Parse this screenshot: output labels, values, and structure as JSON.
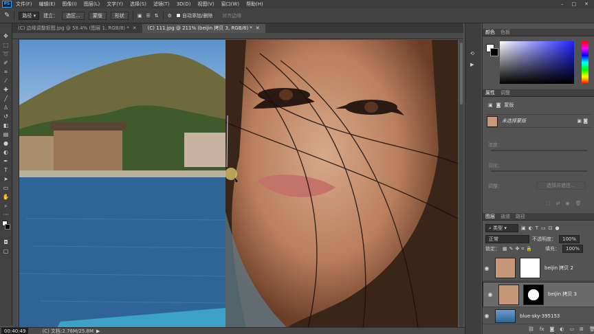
{
  "app": {
    "logo": "PS"
  },
  "menubar": {
    "items": [
      "文件(F)",
      "编辑(E)",
      "图像(I)",
      "图层(L)",
      "文字(Y)",
      "选择(S)",
      "滤镜(T)",
      "3D(D)",
      "视图(V)",
      "窗口(W)",
      "帮助(H)"
    ],
    "window_controls": [
      "–",
      "□",
      "✕"
    ]
  },
  "options_bar": {
    "tool_icon": "pen-icon",
    "mode_value": "路径",
    "make_label": "建立：",
    "selection_button": "选区...",
    "mask_button": "蒙版",
    "shape_button": "形状",
    "auto_add_delete": "自动添加/删除",
    "align_edges": "对齐边缘"
  },
  "tabs": [
    {
      "label": "(C) 边缘调整抠图.jpg @ 58.4% (图层 1, RGB/8) *",
      "active": false
    },
    {
      "label": "(C) 111.jpg @ 211% (beijin 拷贝 3, RGB/8) *",
      "active": true
    }
  ],
  "status": {
    "timer": "00:40:49",
    "doc_info": "(C) 文档:2.76M/25.8M"
  },
  "color_panel": {
    "tabs": [
      "颜色",
      "色板"
    ],
    "fg": "#ffffff",
    "bg": "#000000"
  },
  "properties_panel": {
    "tabs": [
      "属性",
      "调整"
    ],
    "title": "蒙版",
    "layer_label": "未选择蒙版",
    "density_label": "浓度：",
    "feather_label": "羽化：",
    "refine_label": "调整：",
    "select_and_mask": "选择并遮住..."
  },
  "layers_panel": {
    "tabs": [
      "图层",
      "通道",
      "路径"
    ],
    "filter_label": "类型",
    "blend_mode": "正常",
    "opacity_label": "不透明度：",
    "opacity": "100%",
    "lock_label": "锁定：",
    "fill_label": "填充：",
    "fill": "100%",
    "layers": [
      {
        "name": "beijin 拷贝 2",
        "selected": false
      },
      {
        "name": "beijin 拷贝 3",
        "selected": true
      },
      {
        "name": "blue-sky-395153",
        "selected": false
      }
    ],
    "footer_icons": [
      "link-icon",
      "fx-icon",
      "mask-icon",
      "adjustment-icon",
      "folder-icon",
      "new-layer-icon",
      "trash-icon"
    ]
  },
  "toolbar": {
    "tools": [
      "move-icon",
      "marquee-icon",
      "lasso-icon",
      "quick-select-icon",
      "crop-icon",
      "eyedropper-icon",
      "healing-icon",
      "brush-icon",
      "stamp-icon",
      "history-brush-icon",
      "eraser-icon",
      "gradient-icon",
      "blur-icon",
      "dodge-icon",
      "pen-icon",
      "type-icon",
      "path-select-icon",
      "shape-icon",
      "hand-icon",
      "zoom-icon"
    ]
  }
}
